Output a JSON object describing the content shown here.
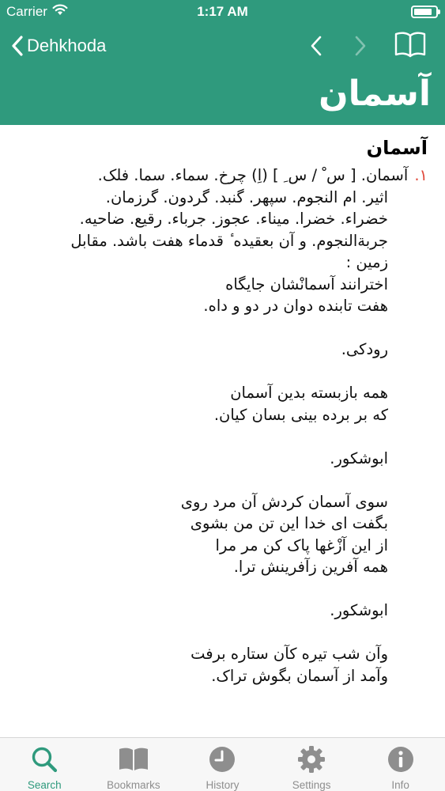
{
  "status_bar": {
    "carrier": "Carrier",
    "time": "1:17 AM",
    "icons": [
      "wifi-icon",
      "battery-icon"
    ]
  },
  "nav": {
    "back_label": "Dehkhoda",
    "title": "آسمان",
    "icons": [
      "chevron-left-icon",
      "chevron-right-icon",
      "book-icon"
    ]
  },
  "entry": {
    "headword": "آسمان",
    "number": "۱.",
    "lines": [
      "آسمان. [ س ْ / س ِ ] (اِ) چرخ. سماء. سما. فلک.",
      "اثیر. ام النجوم. سپهر. گنبد. گردون. گرزمان.",
      "خضراء. خضرا. میناء. عجوز. جرباء. رقیع. ضاحیه.",
      "جربةالنجوم. و آن بعقیده ٔ قدماء هفت باشد. مقابل",
      "زمین :",
      "اخترانند آسمانْشان جایگاه",
      "هفت تابنده دوان در دو و داه.",
      "",
      "رودکی.",
      "",
      "همه بازبسته بدین آسمان",
      "که بر برده بینی بسان کیان.",
      "",
      "ابوشکور.",
      "",
      "سوی آسمان کردش آن مرد روی",
      "بگفت ای خدا این تن من بشوی",
      "از این آزْغها پاک کن مر مرا",
      "همه آفرین زآفرینش ترا.",
      "",
      "ابوشکور.",
      "",
      "وآن شب تیره کآن ستاره برفت",
      "وآمد از آسمان بگوش تراک."
    ]
  },
  "tabs": [
    {
      "label": "Search",
      "icon": "search-icon",
      "active": true
    },
    {
      "label": "Bookmarks",
      "icon": "bookmarks-icon",
      "active": false
    },
    {
      "label": "History",
      "icon": "history-icon",
      "active": false
    },
    {
      "label": "Settings",
      "icon": "settings-icon",
      "active": false
    },
    {
      "label": "Info",
      "icon": "info-icon",
      "active": false
    }
  ],
  "colors": {
    "brand": "#2f9a7d",
    "entry_number": "#e0483a",
    "tab_inactive": "#8e8e8e"
  }
}
